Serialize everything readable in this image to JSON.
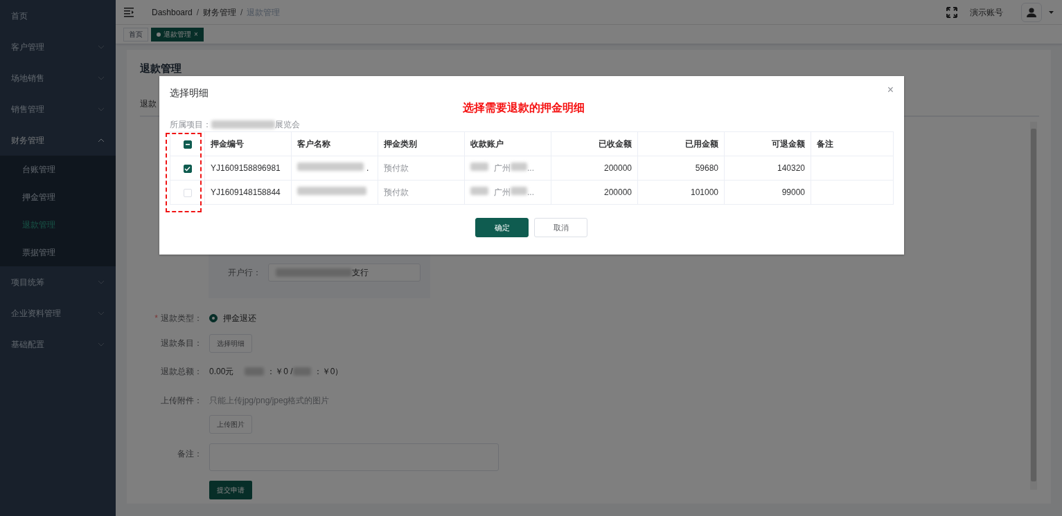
{
  "sidebar": {
    "items": [
      {
        "label": "首页"
      },
      {
        "label": "客户管理",
        "expanded": false
      },
      {
        "label": "场地销售",
        "expanded": false
      },
      {
        "label": "销售管理",
        "expanded": false
      },
      {
        "label": "财务管理",
        "expanded": true,
        "children": [
          {
            "label": "台账管理",
            "selected": false
          },
          {
            "label": "押金管理",
            "selected": false
          },
          {
            "label": "退款管理",
            "selected": true
          },
          {
            "label": "票据管理",
            "selected": false
          }
        ]
      },
      {
        "label": "项目统筹",
        "expanded": false
      },
      {
        "label": "企业资料管理",
        "expanded": false
      },
      {
        "label": "基础配置",
        "expanded": false
      }
    ]
  },
  "header": {
    "breadcrumb": [
      {
        "label": "Dashboard"
      },
      {
        "separator": "/",
        "label": "财务管理"
      },
      {
        "separator": "/",
        "label": "退款管理"
      }
    ],
    "account": "演示账号"
  },
  "tags": [
    {
      "label": "首页",
      "selected": false
    },
    {
      "label": "退款管理",
      "selected": true,
      "close": "×"
    }
  ],
  "page": {
    "title": "退款管理",
    "tab": "退款",
    "bank": {
      "label": "开户行：",
      "value_tail": "支行"
    },
    "refund_type": {
      "label": "退款类型：",
      "required_mark": "*",
      "option": "押金退还",
      "selected": true
    },
    "items": {
      "label": "退款条目：",
      "button": "选择明细"
    },
    "total": {
      "label": "退款总额：",
      "amount": "0.00元",
      "part_1": "：￥0 /",
      "part_2": "：￥0）"
    },
    "attachment": {
      "label": "上传附件：",
      "hint": "只能上传jpg/png/jpeg格式的图片",
      "button": "上传图片"
    },
    "remark": {
      "label": "备注："
    },
    "submit": "提交申请"
  },
  "dialog": {
    "title": "选择明细",
    "annotation": "选择需要退款的押金明细",
    "close": "×",
    "project": {
      "label": "所属项目：",
      "tail": "展览会"
    },
    "table": {
      "header_checkbox": {
        "indeterminate": true
      },
      "columns": [
        {
          "label": "押金编号",
          "kind": "text"
        },
        {
          "label": "客户名称",
          "kind": "text"
        },
        {
          "label": "押金类别",
          "kind": "text"
        },
        {
          "label": "收款账户",
          "kind": "text"
        },
        {
          "label": "已收金额",
          "kind": "number"
        },
        {
          "label": "已用金额",
          "kind": "number"
        },
        {
          "label": "可退金额",
          "kind": "number"
        },
        {
          "label": "备注",
          "kind": "text"
        }
      ],
      "rows": [
        {
          "selected": true,
          "id": "YJ1609158896981",
          "name_tail": ".",
          "category": "预付款",
          "account": "广州",
          "account_tail": "...",
          "received": "200000",
          "used": "59680",
          "refundable": "140320"
        },
        {
          "selected": false,
          "id": "YJ1609148158844",
          "category": "预付款",
          "account": "广州",
          "account_tail": "...",
          "received": "200000",
          "used": "101000",
          "refundable": "99000"
        }
      ]
    },
    "buttons": [
      {
        "label": "确定",
        "kind": "primary"
      },
      {
        "label": "取消",
        "kind": "secondary"
      }
    ]
  }
}
